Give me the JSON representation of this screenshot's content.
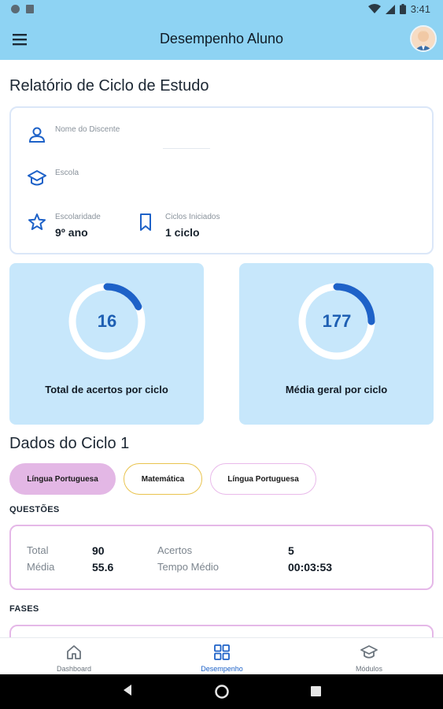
{
  "status_bar": {
    "time": "3:41"
  },
  "app_bar": {
    "title": "Desempenho Aluno"
  },
  "report": {
    "title": "Relatório de Ciclo de Estudo",
    "student_label": "Nome do Discente",
    "student_value": "",
    "school_label": "Escola",
    "school_value": "",
    "grade_label": "Escolaridade",
    "grade_value": "9º ano",
    "cycles_label": "Ciclos Iniciados",
    "cycles_value": "1 ciclo"
  },
  "stats": [
    {
      "value": "16",
      "label": "Total de acertos por ciclo",
      "progress": 0.18
    },
    {
      "value": "177",
      "label": "Média geral por ciclo",
      "progress": 0.25
    }
  ],
  "cycle": {
    "title": "Dados do Ciclo 1",
    "chips": [
      "Língua Portuguesa",
      "Matemática",
      "Língua Portuguesa"
    ]
  },
  "questions": {
    "heading": "QUESTÕES",
    "total_label": "Total",
    "total_value": "90",
    "media_label": "Média",
    "media_value": "55.6",
    "acertos_label": "Acertos",
    "acertos_value": "5",
    "tempo_label": "Tempo Médio",
    "tempo_value": "00:03:53"
  },
  "fases": {
    "heading": "FASES"
  },
  "bottom_nav": {
    "items": [
      {
        "label": "Dashboard",
        "icon": "home-icon"
      },
      {
        "label": "Desempenho",
        "icon": "grid-icon"
      },
      {
        "label": "Módulos",
        "icon": "graduation-cap-icon"
      }
    ],
    "active_index": 1
  },
  "colors": {
    "app_bar": "#8ed3f3",
    "stat_card": "#c7e7fb",
    "ring_accent": "#1e62c8",
    "active_chip": "#e3b7e5",
    "chip_yellow_border": "#e9c34d"
  }
}
